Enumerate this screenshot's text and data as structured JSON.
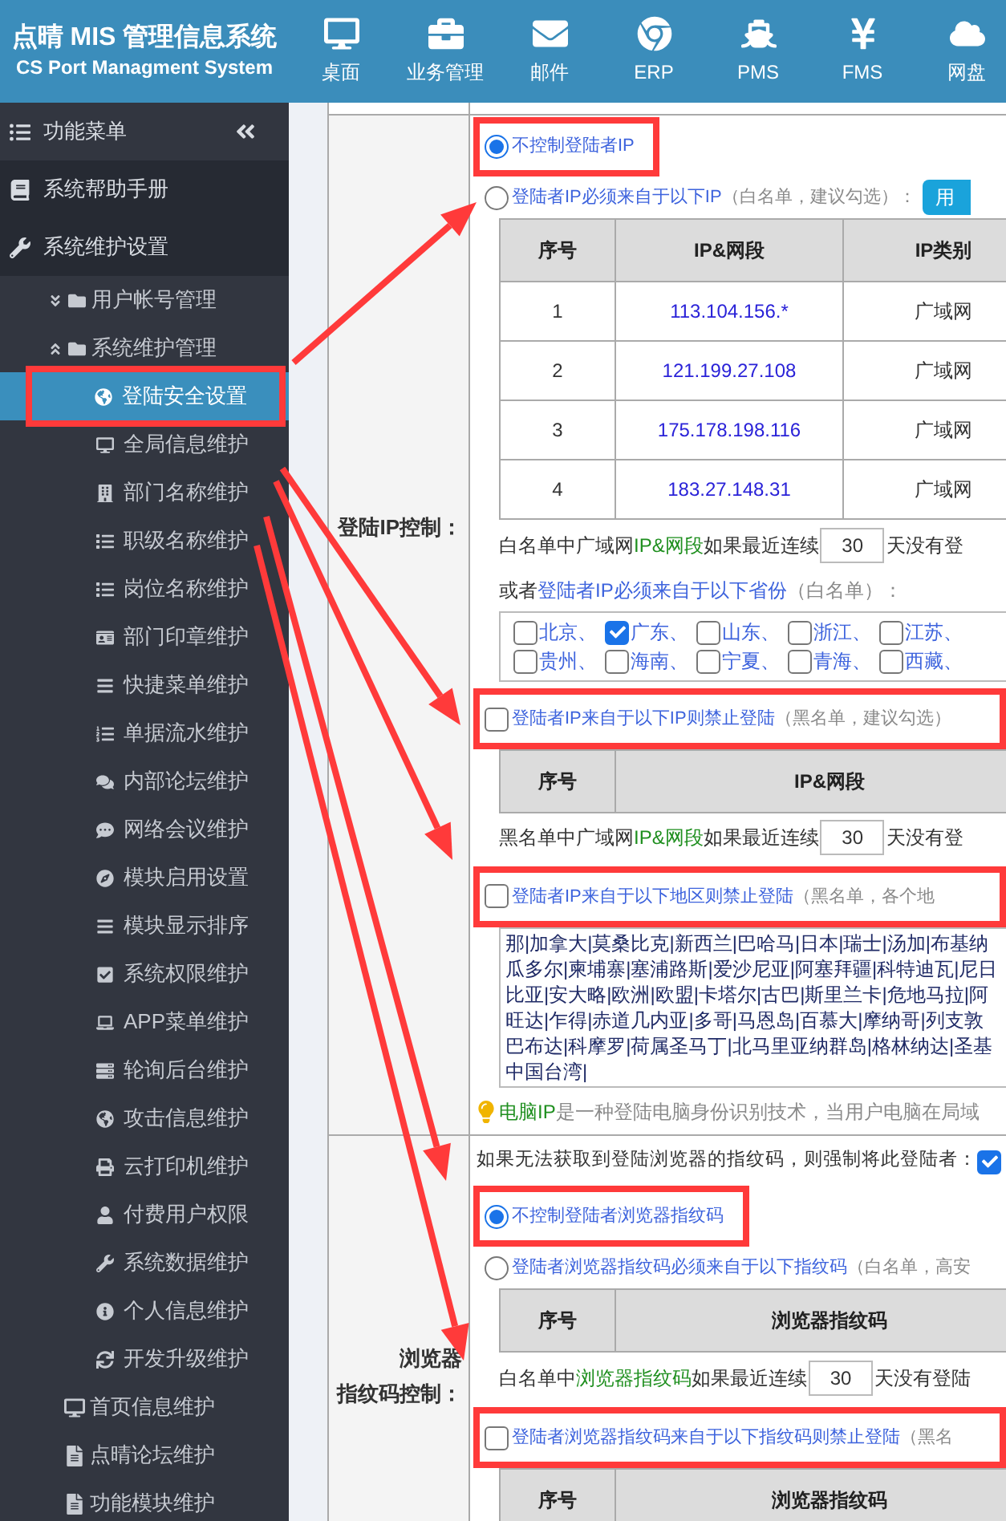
{
  "header": {
    "title": "点晴 MIS 管理信息系统",
    "subtitle": "CS Port Managment System",
    "nav": [
      {
        "label": "桌面"
      },
      {
        "label": "业务管理"
      },
      {
        "label": "邮件"
      },
      {
        "label": "ERP"
      },
      {
        "label": "PMS"
      },
      {
        "label": "FMS"
      },
      {
        "label": "网盘"
      }
    ]
  },
  "sidebar": {
    "title": "功能菜单",
    "items": [
      {
        "label": "系统帮助手册"
      },
      {
        "label": "系统维护设置",
        "children": [
          {
            "label": "用户帐号管理",
            "kind": "folder",
            "expanded": false
          },
          {
            "label": "系统维护管理",
            "kind": "folder",
            "expanded": true,
            "children": [
              {
                "label": "登陆安全设置",
                "selected": true,
                "highlighted": true
              },
              {
                "label": "全局信息维护",
                "selected": false,
                "highlighted": false
              },
              {
                "label": "部门名称维护",
                "selected": false,
                "highlighted": false
              },
              {
                "label": "职级名称维护",
                "selected": false,
                "highlighted": false
              },
              {
                "label": "岗位名称维护",
                "selected": false,
                "highlighted": false
              },
              {
                "label": "部门印章维护",
                "selected": false,
                "highlighted": false
              },
              {
                "label": "快捷菜单维护",
                "selected": false,
                "highlighted": false
              },
              {
                "label": "单据流水维护",
                "selected": false,
                "highlighted": false
              },
              {
                "label": "内部论坛维护",
                "selected": false,
                "highlighted": false
              },
              {
                "label": "网络会议维护",
                "selected": false,
                "highlighted": false
              },
              {
                "label": "模块启用设置",
                "selected": false,
                "highlighted": false
              },
              {
                "label": "模块显示排序",
                "selected": false,
                "highlighted": false
              },
              {
                "label": "系统权限维护",
                "selected": false,
                "highlighted": false
              },
              {
                "label": "APP菜单维护",
                "selected": false,
                "highlighted": false
              },
              {
                "label": "轮询后台维护",
                "selected": false,
                "highlighted": false
              },
              {
                "label": "攻击信息维护",
                "selected": false,
                "highlighted": false
              },
              {
                "label": "云打印机维护",
                "selected": false,
                "highlighted": false
              },
              {
                "label": "付费用户权限",
                "selected": false,
                "highlighted": false
              },
              {
                "label": "系统数据维护",
                "selected": false,
                "highlighted": false
              },
              {
                "label": "个人信息维护",
                "selected": false,
                "highlighted": false
              },
              {
                "label": "开发升级维护",
                "selected": false,
                "highlighted": false
              }
            ]
          },
          {
            "label": "首页信息维护",
            "kind": "page"
          },
          {
            "label": "点晴论坛维护",
            "kind": "page"
          },
          {
            "label": "功能模块维护",
            "kind": "page"
          }
        ]
      }
    ]
  },
  "sections": [
    {
      "label_lines": [
        "登陆IP控制："
      ],
      "blocks": [
        {
          "kind": "radio",
          "selected": true,
          "highlighted": true,
          "parts": [
            {
              "text": "不控制登陆者IP",
              "kind": "link"
            }
          ]
        },
        {
          "kind": "radio",
          "selected": false,
          "highlighted": false,
          "parts": [
            {
              "text": "登陆者IP必须来自于以下IP",
              "kind": "link"
            },
            {
              "text": "（白名单，建议勾选）：",
              "kind": "note"
            }
          ],
          "button": "用"
        },
        {
          "kind": "table",
          "columns": [
            {
              "label": "序号",
              "kind": "index"
            },
            {
              "label": "IP&网段",
              "kind": "address"
            },
            {
              "label": "IP类别",
              "kind": "type"
            }
          ],
          "rows": [
            [
              "1",
              "113.104.156.*",
              "广域网"
            ],
            [
              "2",
              "121.199.27.108",
              "广域网"
            ],
            [
              "3",
              "175.178.198.116",
              "广域网"
            ],
            [
              "4",
              "183.27.148.31",
              "广域网"
            ]
          ]
        },
        {
          "kind": "threshold",
          "parts": [
            {
              "text": "白名单中广域网",
              "kind": "plain"
            },
            {
              "text": "IP&网段",
              "kind": "term"
            },
            {
              "text": "如果最近连续",
              "kind": "plain"
            }
          ],
          "value": "30",
          "after": "天没有登"
        },
        {
          "kind": "text",
          "parts": [
            {
              "text": "或者",
              "kind": "plain"
            },
            {
              "text": "登陆者IP必须来自于以下省份",
              "kind": "link"
            },
            {
              "text": "（白名单）：",
              "kind": "note"
            }
          ]
        },
        {
          "kind": "provinces",
          "rows": [
            [
              {
                "label": "北京、",
                "checked": false
              },
              {
                "label": "广东、",
                "checked": true
              },
              {
                "label": "山东、",
                "checked": false
              },
              {
                "label": "浙江、",
                "checked": false
              },
              {
                "label": "江苏、",
                "checked": false
              }
            ],
            [
              {
                "label": "贵州、",
                "checked": false
              },
              {
                "label": "海南、",
                "checked": false
              },
              {
                "label": "宁夏、",
                "checked": false
              },
              {
                "label": "青海、",
                "checked": false
              },
              {
                "label": "西藏、",
                "checked": false
              }
            ]
          ]
        },
        {
          "kind": "checkbox",
          "checked": false,
          "highlighted": true,
          "parts": [
            {
              "text": "登陆者IP来自于以下IP则禁止登陆",
              "kind": "link"
            },
            {
              "text": "（黑名单，建议勾选）",
              "kind": "note"
            }
          ]
        },
        {
          "kind": "table",
          "columns": [
            {
              "label": "序号",
              "kind": "index"
            },
            {
              "label": "IP&网段",
              "kind": "address"
            }
          ]
        },
        {
          "kind": "threshold",
          "parts": [
            {
              "text": "黑名单中广域网",
              "kind": "plain"
            },
            {
              "text": "IP&网段",
              "kind": "term"
            },
            {
              "text": "如果最近连续",
              "kind": "plain"
            }
          ],
          "value": "30",
          "after": "天没有登"
        },
        {
          "kind": "checkbox",
          "checked": false,
          "highlighted": true,
          "parts": [
            {
              "text": "登陆者IP来自于以下地区则禁止登陆",
              "kind": "link"
            },
            {
              "text": "（黑名单，各个地",
              "kind": "note"
            }
          ]
        },
        {
          "kind": "regions",
          "lines": [
            "那|加拿大|莫桑比克|新西兰|巴哈马|日本|瑞士|汤加|布基纳",
            "瓜多尔|柬埔寨|塞浦路斯|爱沙尼亚|阿塞拜疆|科特迪瓦|尼日",
            "比亚|安大略|欧洲|欧盟|卡塔尔|古巴|斯里兰卡|危地马拉|阿",
            "旺达|乍得|赤道几内亚|多哥|马恩岛|百慕大|摩纳哥|列支敦",
            "巴布达|科摩罗|荷属圣马丁|北马里亚纳群岛|格林纳达|圣基",
            "中国台湾|"
          ]
        },
        {
          "kind": "tip",
          "parts": [
            {
              "text": "电脑IP",
              "kind": "term"
            },
            {
              "text": "是一种登陆电脑身份识别技术，当用户电脑在局域",
              "kind": "note"
            }
          ]
        }
      ]
    },
    {
      "label_lines": [
        "浏览器",
        "指纹码控制："
      ],
      "blocks": [
        {
          "kind": "notice",
          "text": "如果无法获取到登陆浏览器的指纹码，则强制将此登陆者：",
          "checked": true
        },
        {
          "kind": "radio",
          "selected": true,
          "highlighted": true,
          "parts": [
            {
              "text": "不控制登陆者浏览器指纹码",
              "kind": "link"
            }
          ]
        },
        {
          "kind": "radio",
          "selected": false,
          "highlighted": false,
          "parts": [
            {
              "text": "登陆者浏览器指纹码必须来自于以下指纹码",
              "kind": "link"
            },
            {
              "text": "（白名单，高安",
              "kind": "note"
            }
          ]
        },
        {
          "kind": "table",
          "columns": [
            {
              "label": "序号",
              "kind": "index"
            },
            {
              "label": "浏览器指纹码",
              "kind": "code"
            }
          ]
        },
        {
          "kind": "threshold",
          "parts": [
            {
              "text": "白名单中",
              "kind": "plain"
            },
            {
              "text": "浏览器指纹码",
              "kind": "term"
            },
            {
              "text": "如果最近连续",
              "kind": "plain"
            }
          ],
          "value": "30",
          "after": "天没有登陆"
        },
        {
          "kind": "checkbox",
          "checked": false,
          "highlighted": true,
          "parts": [
            {
              "text": "登陆者浏览器指纹码来自于以下指纹码则禁止登陆",
              "kind": "link"
            },
            {
              "text": "（黑名",
              "kind": "note"
            }
          ]
        },
        {
          "kind": "table",
          "columns": [
            {
              "label": "序号",
              "kind": "index"
            },
            {
              "label": "浏览器指纹码",
              "kind": "code"
            }
          ]
        }
      ]
    }
  ]
}
